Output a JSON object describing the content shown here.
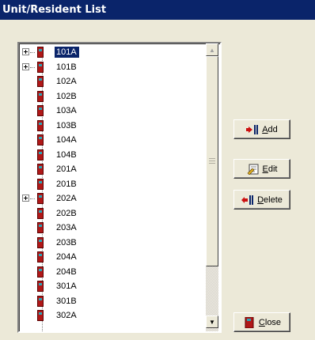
{
  "window": {
    "title": "Unit/Resident List"
  },
  "list": {
    "items": [
      {
        "label": "101A",
        "expandable": true,
        "selected": true
      },
      {
        "label": "101B",
        "expandable": true,
        "selected": false
      },
      {
        "label": "102A",
        "expandable": false,
        "selected": false
      },
      {
        "label": "102B",
        "expandable": false,
        "selected": false
      },
      {
        "label": "103A",
        "expandable": false,
        "selected": false
      },
      {
        "label": "103B",
        "expandable": false,
        "selected": false
      },
      {
        "label": "104A",
        "expandable": false,
        "selected": false
      },
      {
        "label": "104B",
        "expandable": false,
        "selected": false
      },
      {
        "label": "201A",
        "expandable": false,
        "selected": false
      },
      {
        "label": "201B",
        "expandable": false,
        "selected": false
      },
      {
        "label": "202A",
        "expandable": true,
        "selected": false
      },
      {
        "label": "202B",
        "expandable": false,
        "selected": false
      },
      {
        "label": "203A",
        "expandable": false,
        "selected": false
      },
      {
        "label": "203B",
        "expandable": false,
        "selected": false
      },
      {
        "label": "204A",
        "expandable": false,
        "selected": false
      },
      {
        "label": "204B",
        "expandable": false,
        "selected": false
      },
      {
        "label": "301A",
        "expandable": false,
        "selected": false
      },
      {
        "label": "301B",
        "expandable": false,
        "selected": false
      },
      {
        "label": "302A",
        "expandable": false,
        "selected": false
      }
    ],
    "item_icon": "door-icon",
    "expander_icon": "plus-expander-icon"
  },
  "buttons": {
    "add": {
      "label": "Add",
      "icon": "add-unit-icon"
    },
    "edit": {
      "label": "Edit",
      "icon": "edit-note-icon"
    },
    "delete": {
      "label": "Delete",
      "icon": "delete-unit-icon"
    },
    "close": {
      "label": "Close",
      "icon": "door-icon"
    }
  },
  "colors": {
    "titlebar": "#0a246a",
    "selection": "#0a246a",
    "door": "#b01818",
    "door_window": "#2aa6b8",
    "dialog_bg": "#ece9d8"
  }
}
